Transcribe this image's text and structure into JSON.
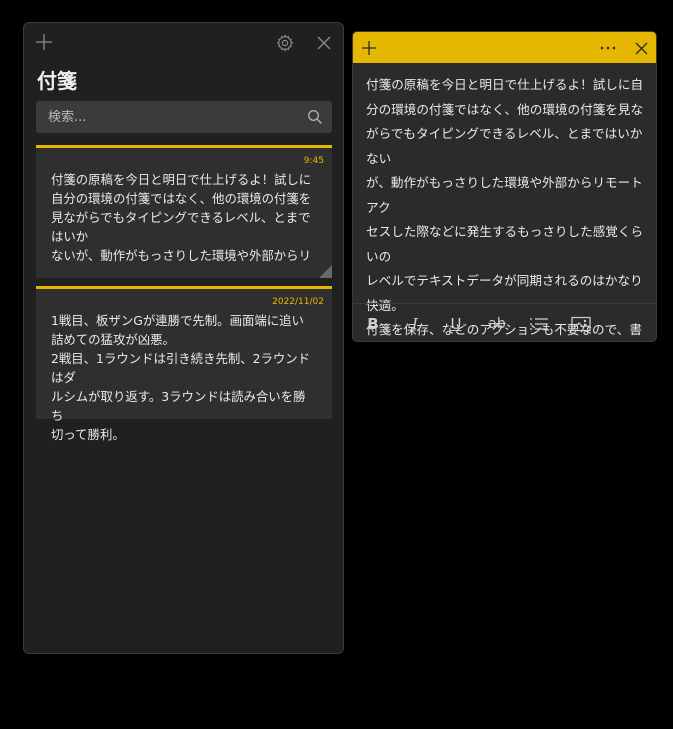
{
  "list_panel": {
    "title": "付箋",
    "search": {
      "placeholder": "検索..."
    },
    "notes": [
      {
        "timestamp": "9:45",
        "text": "付箋の原稿を今日と明日で仕上げるよ！試しに\n自分の環境の付箋ではなく、他の環境の付箋を\n見ながらでもタイピングできるレベル、とまではいか\nないが、動作がもっさりした環境や外部からリモー\nトアクセスした際などに発生するもっさりした感..."
      },
      {
        "timestamp": "2022/11/02",
        "text": "1戦目、板ザンGが連勝で先制。画面端に追い\n詰めての猛攻が凶悪。\n2戦目、1ラウンドは引き続き先制、2ラウンドはダ\nルシムが取り返す。3ラウンドは読み合いを勝ち\n切って勝利。"
      }
    ]
  },
  "editor": {
    "text": "付箋の原稿を今日と明日で仕上げるよ！試しに自\n分の環境の付箋ではなく、他の環境の付箋を見な\nがらでもタイピングできるレベル、とまではいかない\nが、動作がもっさりした環境や外部からリモートアク\nセスした際などに発生するもっさりした感覚くらいの\nレベルでテキストデータが同期されるのはかなり快適。\n付箋を保存、などのアクションも不要なので、書いた\n瞬間にバックアップされるような感覚で使える",
    "toolbar": {
      "bold": "B",
      "italic": "I",
      "underline": "U",
      "strike": "ab"
    }
  },
  "colors": {
    "accent": "#e6b700",
    "panel": "#202020",
    "card": "#2f2f2f"
  },
  "icons": [
    "plus-icon",
    "gear-icon",
    "close-icon",
    "search-icon",
    "more-icon",
    "list-icon",
    "image-icon"
  ]
}
